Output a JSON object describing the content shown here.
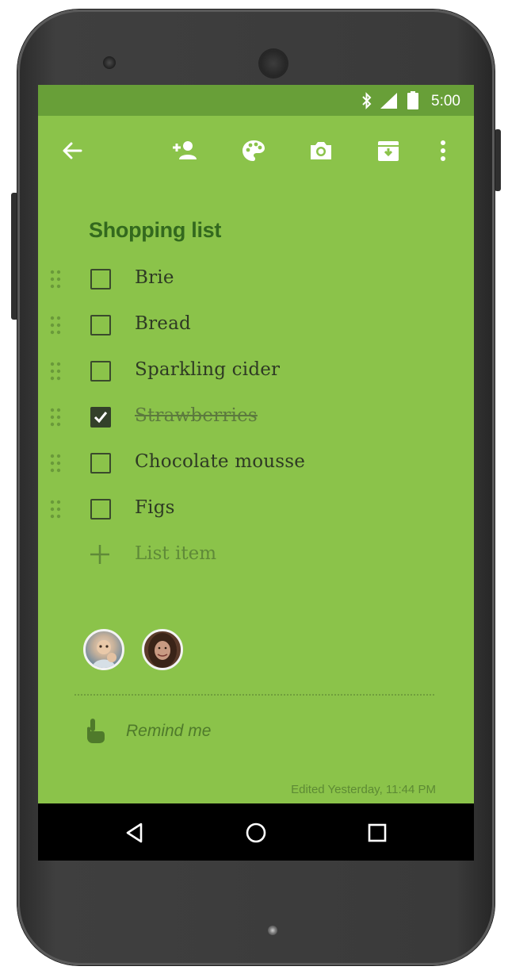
{
  "status_bar": {
    "time": "5:00",
    "icons": [
      "bluetooth-icon",
      "signal-icon",
      "battery-icon"
    ]
  },
  "toolbar": {
    "icons": [
      "back-arrow-icon",
      "add-collaborator-icon",
      "palette-icon",
      "camera-icon",
      "archive-icon",
      "more-vert-icon"
    ]
  },
  "note": {
    "title": "Shopping list",
    "items": [
      {
        "label": "Brie",
        "checked": false
      },
      {
        "label": "Bread",
        "checked": false
      },
      {
        "label": "Sparkling cider",
        "checked": false
      },
      {
        "label": "Strawberries",
        "checked": true
      },
      {
        "label": "Chocolate mousse",
        "checked": false
      },
      {
        "label": "Figs",
        "checked": false
      }
    ],
    "add_item_placeholder": "List item",
    "reminder_label": "Remind me",
    "edited_text": "Edited Yesterday, 11:44 PM"
  },
  "collaborators": [
    "avatar-child",
    "avatar-woman"
  ],
  "colors": {
    "note_background": "#8bc34a",
    "status_bar": "#689f38",
    "title_text": "#33691e"
  },
  "navigation": {
    "icons": [
      "nav-back-icon",
      "nav-home-icon",
      "nav-recents-icon"
    ]
  }
}
